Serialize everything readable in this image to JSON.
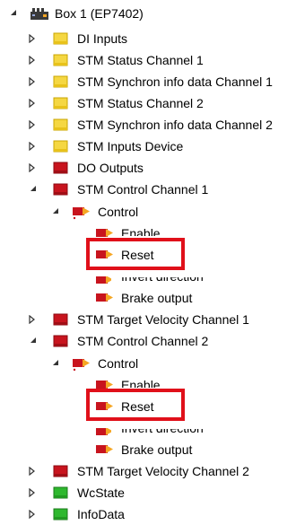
{
  "tree": {
    "root": {
      "label": "Box 1 (EP7402)",
      "expanded": true
    },
    "items": [
      {
        "label": "DI Inputs",
        "icon": "yellow-folder-icon",
        "expanded": false
      },
      {
        "label": "STM Status Channel 1",
        "icon": "yellow-folder-icon",
        "expanded": false
      },
      {
        "label": "STM Synchron info data Channel 1",
        "icon": "yellow-folder-icon",
        "expanded": false
      },
      {
        "label": "STM Status Channel 2",
        "icon": "yellow-folder-icon",
        "expanded": false
      },
      {
        "label": "STM Synchron info data Channel 2",
        "icon": "yellow-folder-icon",
        "expanded": false
      },
      {
        "label": "STM Inputs Device",
        "icon": "yellow-folder-icon",
        "expanded": false
      },
      {
        "label": "DO Outputs",
        "icon": "red-folder-icon",
        "expanded": false
      },
      {
        "label": "STM Control Channel 1",
        "icon": "red-folder-icon",
        "expanded": true
      },
      {
        "label": "Control",
        "icon": "red-output-icon",
        "expanded": true
      },
      {
        "label": "Enable",
        "icon": "red-output-icon"
      },
      {
        "label": "Reset",
        "icon": "red-output-icon",
        "highlighted": true
      },
      {
        "label": "Invert direction",
        "icon": "red-output-icon"
      },
      {
        "label": "Brake output",
        "icon": "red-output-icon"
      },
      {
        "label": "STM Target Velocity Channel 1",
        "icon": "red-folder-icon",
        "expanded": false
      },
      {
        "label": "STM Control Channel 2",
        "icon": "red-folder-icon",
        "expanded": true
      },
      {
        "label": "Control",
        "icon": "red-output-icon",
        "expanded": true
      },
      {
        "label": "Enable",
        "icon": "red-output-icon"
      },
      {
        "label": "Reset",
        "icon": "red-output-icon",
        "highlighted": true
      },
      {
        "label": "Invert direction",
        "icon": "red-output-icon"
      },
      {
        "label": "Brake output",
        "icon": "red-output-icon"
      },
      {
        "label": "STM Target Velocity Channel 2",
        "icon": "red-folder-icon",
        "expanded": false
      },
      {
        "label": "WcState",
        "icon": "green-folder-icon",
        "expanded": false
      },
      {
        "label": "InfoData",
        "icon": "green-folder-icon",
        "expanded": false
      }
    ]
  },
  "colors": {
    "highlight": "#e0101a",
    "yellow_folder": "#f5d742",
    "red_folder": "#c8141e",
    "green_folder": "#2eb82e"
  }
}
